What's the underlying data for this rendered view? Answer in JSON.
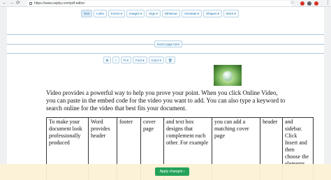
{
  "browser": {
    "back": "←",
    "forward": "→",
    "reload": "⟳",
    "url": "https://www.sejda.com/pdf-editor",
    "extension_colors": [
      "#d93025",
      "#5f6368",
      "#d93025"
    ]
  },
  "top_toolbar": [
    {
      "label": "Text",
      "icon": "text-icon",
      "active": true
    },
    {
      "label": "Links",
      "icon": "link-icon"
    },
    {
      "label": "Forms ▾",
      "icon": "forms-icon"
    },
    {
      "label": "Images ▾",
      "icon": "image-icon"
    },
    {
      "label": "Sign ▾",
      "icon": "pen-icon"
    },
    {
      "label": "Whiteout",
      "icon": "whiteout-icon"
    },
    {
      "label": "Annotate ▾",
      "icon": "annotate-icon"
    },
    {
      "label": "Shapes ▾",
      "icon": "shapes-icon"
    },
    {
      "label": "More ▾",
      "icon": "more-icon"
    }
  ],
  "insert_page": "Insert page here",
  "format_toolbar": {
    "bold": "B",
    "italic": "I",
    "size": "Tt ▾",
    "font": "Font ▾",
    "color": "Color ▾",
    "delete_icon": "trash-icon"
  },
  "paragraph": "Video provides a powerful way to help you prove your point. When you click Online Video, you can paste in the embed code for the video you want to add. You can also type a keyword to search online for the video that best fits your document.",
  "table": {
    "cells": [
      "To make your document look professionally produced",
      "Word provides header",
      "footer",
      "cover page",
      "and text box designs that complement each other. For example",
      "you can add a matching cover page",
      "header",
      "and sidebar. Click Insert and then choose the elements"
    ]
  },
  "apply_button": "Apply changes ›"
}
